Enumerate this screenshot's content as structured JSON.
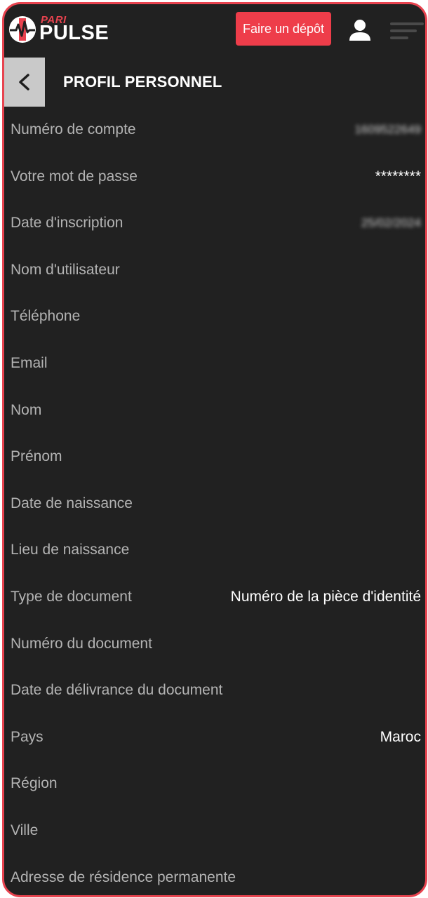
{
  "header": {
    "logo_top": "PARI",
    "logo_bottom": "PULSE",
    "deposit_label": "Faire un dépôt",
    "brand_color": "#ee3d4a",
    "icons": [
      "logo-mark-icon",
      "user-icon",
      "menu-icon"
    ]
  },
  "page": {
    "title": "PROFIL PERSONNEL",
    "back_icon": "chevron-left-icon"
  },
  "profile": {
    "rows": [
      {
        "label": "Numéro de compte",
        "value": "1609522649",
        "blurred": true
      },
      {
        "label": "Votre mot de passe",
        "value": "********",
        "blurred": false
      },
      {
        "label": "Date d'inscription",
        "value": "25/02/2024",
        "blurred": true
      },
      {
        "label": "Nom d'utilisateur",
        "value": "",
        "blurred": false
      },
      {
        "label": "Téléphone",
        "value": "",
        "blurred": false
      },
      {
        "label": "Email",
        "value": "",
        "blurred": false
      },
      {
        "label": "Nom",
        "value": "",
        "blurred": false
      },
      {
        "label": "Prénom",
        "value": "",
        "blurred": false
      },
      {
        "label": "Date de naissance",
        "value": "",
        "blurred": false
      },
      {
        "label": "Lieu de naissance",
        "value": "",
        "blurred": false
      },
      {
        "label": "Type de document",
        "value": "Numéro de la pièce d'identité",
        "blurred": false
      },
      {
        "label": "Numéro du document",
        "value": "",
        "blurred": false
      },
      {
        "label": "Date de délivrance du document",
        "value": "",
        "blurred": false
      },
      {
        "label": "Pays",
        "value": "Maroc",
        "blurred": false
      },
      {
        "label": "Région",
        "value": "",
        "blurred": false
      },
      {
        "label": "Ville",
        "value": "",
        "blurred": false
      },
      {
        "label": "Adresse de résidence permanente",
        "value": "",
        "blurred": false
      }
    ]
  }
}
